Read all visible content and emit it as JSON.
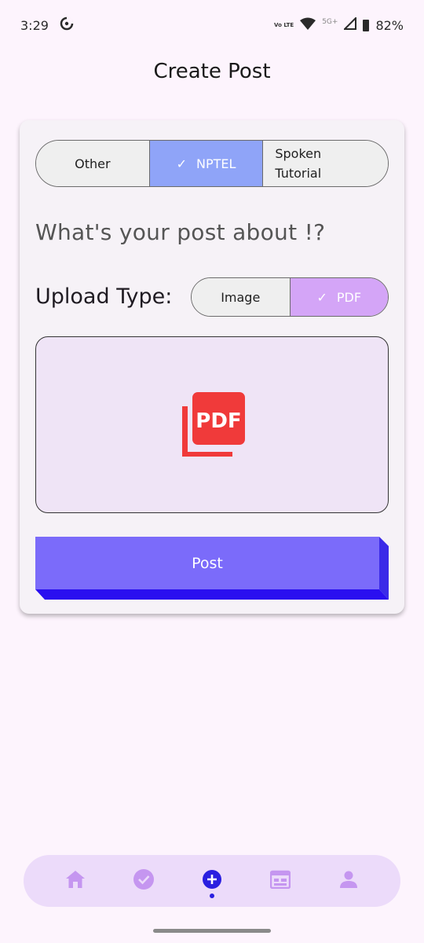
{
  "status": {
    "time": "3:29",
    "network": "5G+",
    "volte": "Vo LTE",
    "battery": "82%"
  },
  "header": {
    "title": "Create Post"
  },
  "category": {
    "options": [
      "Other",
      "NPTEL",
      "Spoken\nTutorial"
    ],
    "selected": "NPTEL"
  },
  "form": {
    "question": "What's your post about !?",
    "upload_label": "Upload Type:"
  },
  "upload_type": {
    "options": [
      "Image",
      "PDF"
    ],
    "selected": "PDF"
  },
  "preview": {
    "icon": "pdf-file-icon",
    "icon_text": "PDF"
  },
  "post_button": {
    "label": "Post"
  },
  "bottom_nav": {
    "items": [
      "home-icon",
      "check-circle-icon",
      "add-circle-icon",
      "calendar-icon",
      "person-icon"
    ],
    "active": "add-circle-icon"
  },
  "colors": {
    "background": "#fdf4fd",
    "category_selected": "#8fa4f8",
    "upload_selected": "#d4a5f7",
    "post_button": "#7b6bfa",
    "nav_active": "#2a1fe0",
    "nav_inactive": "#c596f0",
    "pdf_red": "#f03a3a"
  }
}
